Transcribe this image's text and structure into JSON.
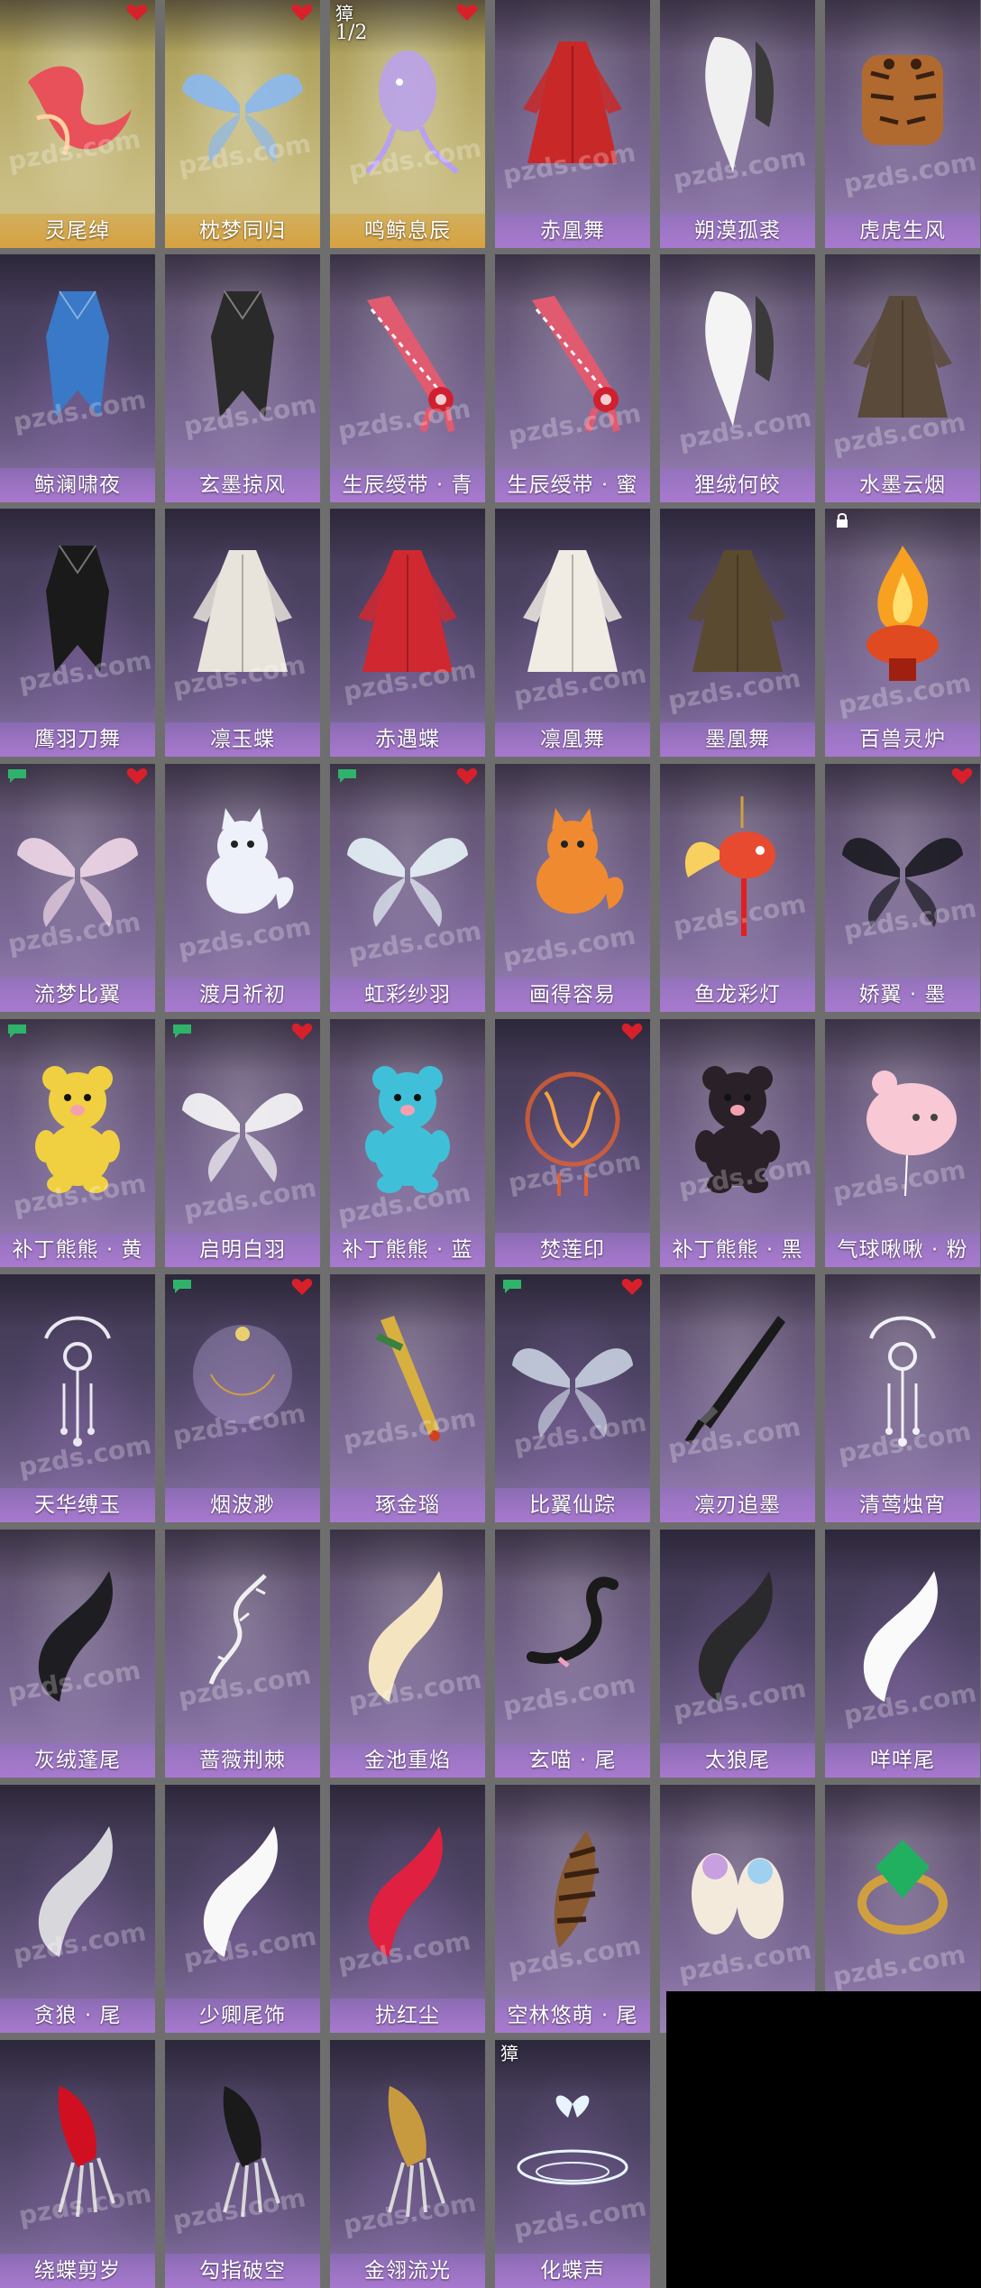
{
  "watermark": "pzds.com",
  "badge_glyph": "獐",
  "badge_fraction": "1/2",
  "rows": [
    [
      {
        "name": "灵尾绰",
        "icon": "ribbon-icon",
        "color": "#e8505a",
        "theme": "gold",
        "mark": "heart"
      },
      {
        "name": "枕梦同归",
        "icon": "wings-icon",
        "color": "#8ab8f0",
        "theme": "gold",
        "mark": "heart"
      },
      {
        "name": "鸣鲸息辰",
        "icon": "whale-icon",
        "color": "#b8a0f0",
        "theme": "gold",
        "mark": "heart",
        "badge": true
      },
      {
        "name": "赤凰舞",
        "icon": "robe-icon",
        "color": "#c82828",
        "theme": "normal"
      },
      {
        "name": "朔漠孤裘",
        "icon": "fur-cloak-icon",
        "color": "#f0f0f0",
        "theme": "normal"
      },
      {
        "name": "虎虎生风",
        "icon": "tiger-outfit-icon",
        "color": "#b06a30",
        "theme": "normal"
      }
    ],
    [
      {
        "name": "鲸澜啸夜",
        "icon": "cape-icon",
        "color": "#3a78c8",
        "theme": "dark"
      },
      {
        "name": "玄墨掠风",
        "icon": "cape-icon",
        "color": "#2a2a2a",
        "theme": "normal"
      },
      {
        "name": "生辰绶带 · 青",
        "icon": "sash-icon",
        "color": "#e05a70",
        "theme": "normal"
      },
      {
        "name": "生辰绶带 · 蜜",
        "icon": "sash-icon",
        "color": "#e05a70",
        "theme": "normal"
      },
      {
        "name": "狸绒何皎",
        "icon": "fur-cloak-icon",
        "color": "#f4f4f4",
        "theme": "normal"
      },
      {
        "name": "水墨云烟",
        "icon": "robe-icon",
        "color": "#5a4a3a",
        "theme": "normal"
      }
    ],
    [
      {
        "name": "鹰羽刀舞",
        "icon": "cape-icon",
        "color": "#1a1a1a",
        "theme": "dark"
      },
      {
        "name": "凛玉蝶",
        "icon": "robe-icon",
        "color": "#e8e4dc",
        "theme": "dark"
      },
      {
        "name": "赤遇蝶",
        "icon": "robe-icon",
        "color": "#d02830",
        "theme": "dark"
      },
      {
        "name": "凛凰舞",
        "icon": "robe-icon",
        "color": "#f0ece4",
        "theme": "dark"
      },
      {
        "name": "墨凰舞",
        "icon": "robe-icon",
        "color": "#5a4a30",
        "theme": "dark"
      },
      {
        "name": "百兽灵炉",
        "icon": "flame-censer-icon",
        "color": "#e04a20",
        "theme": "normal",
        "mark": "lock"
      }
    ],
    [
      {
        "name": "流梦比翼",
        "icon": "wings-icon",
        "color": "#f0d8e8",
        "theme": "normal",
        "mark": "heart",
        "chat": true
      },
      {
        "name": "渡月祈初",
        "icon": "fox-pet-icon",
        "color": "#eef0fa",
        "theme": "normal"
      },
      {
        "name": "虹彩纱羽",
        "icon": "wings-icon",
        "color": "#e8f4f8",
        "theme": "normal",
        "mark": "heart",
        "chat": true
      },
      {
        "name": "画得容易",
        "icon": "fox-pet-icon",
        "color": "#f08a30",
        "theme": "normal"
      },
      {
        "name": "鱼龙彩灯",
        "icon": "fish-lantern-icon",
        "color": "#e84a30",
        "theme": "normal"
      },
      {
        "name": "娇翼 · 墨",
        "icon": "wings-icon",
        "color": "#1a1a20",
        "theme": "normal",
        "mark": "heart"
      }
    ],
    [
      {
        "name": "补丁熊熊 · 黄",
        "icon": "teddy-bear-icon",
        "color": "#f0d040",
        "theme": "normal",
        "chat": true
      },
      {
        "name": "启明白羽",
        "icon": "wings-icon",
        "color": "#f8f8f8",
        "theme": "normal",
        "mark": "heart",
        "chat": true
      },
      {
        "name": "补丁熊熊 · 蓝",
        "icon": "teddy-bear-icon",
        "color": "#40c0d8",
        "theme": "normal"
      },
      {
        "name": "焚莲印",
        "icon": "flame-ring-icon",
        "color": "#e06030",
        "theme": "dark",
        "mark": "heart"
      },
      {
        "name": "补丁熊熊 · 黑",
        "icon": "teddy-bear-icon",
        "color": "#2a2028",
        "theme": "normal"
      },
      {
        "name": "气球啾啾 · 粉",
        "icon": "balloon-icon",
        "color": "#f8c8d4",
        "theme": "normal"
      }
    ],
    [
      {
        "name": "天华缚玉",
        "icon": "pendant-icon",
        "color": "#e8e8f0",
        "theme": "dark"
      },
      {
        "name": "烟波渺",
        "icon": "ring-orb-icon",
        "color": "#c0b0e0",
        "theme": "dark",
        "mark": "heart",
        "chat": true
      },
      {
        "name": "琢金瑙",
        "icon": "dagger-icon",
        "color": "#d8b040",
        "theme": "normal"
      },
      {
        "name": "比翼仙踪",
        "icon": "wings-icon",
        "color": "#c8d0e0",
        "theme": "dark",
        "mark": "heart",
        "chat": true
      },
      {
        "name": "凛刃追墨",
        "icon": "sword-icon",
        "color": "#1a1a1a",
        "theme": "normal"
      },
      {
        "name": "清莺烛宵",
        "icon": "pendant-icon",
        "color": "#f0f0f8",
        "theme": "normal"
      }
    ],
    [
      {
        "name": "灰绒蓬尾",
        "icon": "tail-icon",
        "color": "#1e1e22",
        "theme": "normal"
      },
      {
        "name": "蔷薇荆棘",
        "icon": "thorn-tail-icon",
        "color": "#f0f0f0",
        "theme": "normal"
      },
      {
        "name": "金池重焰",
        "icon": "tail-icon",
        "color": "#f4e4c0",
        "theme": "normal"
      },
      {
        "name": "玄喵 · 尾",
        "icon": "cat-tail-icon",
        "color": "#1a1a1a",
        "theme": "normal"
      },
      {
        "name": "太狼尾",
        "icon": "tail-icon",
        "color": "#2a2a2c",
        "theme": "dark"
      },
      {
        "name": "咩咩尾",
        "icon": "tail-icon",
        "color": "#fafafa",
        "theme": "dark"
      }
    ],
    [
      {
        "name": "贪狼 · 尾",
        "icon": "tail-icon",
        "color": "#d8d8dc",
        "theme": "dark"
      },
      {
        "name": "少卿尾饰",
        "icon": "tail-icon",
        "color": "#f8f8f8",
        "theme": "dark"
      },
      {
        "name": "扰红尘",
        "icon": "tail-icon",
        "color": "#e02040",
        "theme": "dark"
      },
      {
        "name": "空林悠萌 · 尾",
        "icon": "striped-tail-icon",
        "color": "#8a5a30",
        "theme": "normal"
      },
      {
        "name": "",
        "icon": "slippers-icon",
        "color": "#f4eadc",
        "theme": "normal"
      },
      {
        "name": "",
        "icon": "emerald-ring-icon",
        "color": "#20b060",
        "theme": "normal"
      }
    ],
    [
      {
        "name": "绕蝶剪岁",
        "icon": "claw-icon",
        "color": "#d01020",
        "theme": "dark"
      },
      {
        "name": "勾指破空",
        "icon": "claw-icon",
        "color": "#1a1a1a",
        "theme": "dark"
      },
      {
        "name": "金翎流光",
        "icon": "claw-icon",
        "color": "#c89a40",
        "theme": "dark"
      },
      {
        "name": "化蝶声",
        "icon": "butterfly-swirl-icon",
        "color": "#e8f4ff",
        "theme": "dark",
        "badge_glyph_only": true
      }
    ]
  ]
}
